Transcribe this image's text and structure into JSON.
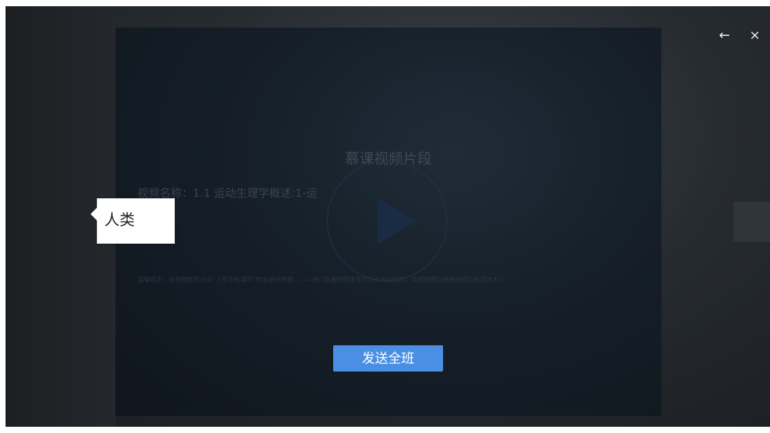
{
  "window_controls": {
    "back_icon": "←",
    "close_icon": "×"
  },
  "player": {
    "title": "慕课视频片段",
    "video_name": "视频名称：1.1 运动生理学概述:1-运",
    "tip": "温馨提示：此视频框在点击“上传手机课件”时会进行转换，——进行观看时则会变为可点击的视频，此视频框可被拖动移位和修改大小",
    "send_button_label": "发送全班"
  },
  "annotation_label": {
    "text": "人类"
  },
  "colors": {
    "accent": "#4a8fe4"
  }
}
